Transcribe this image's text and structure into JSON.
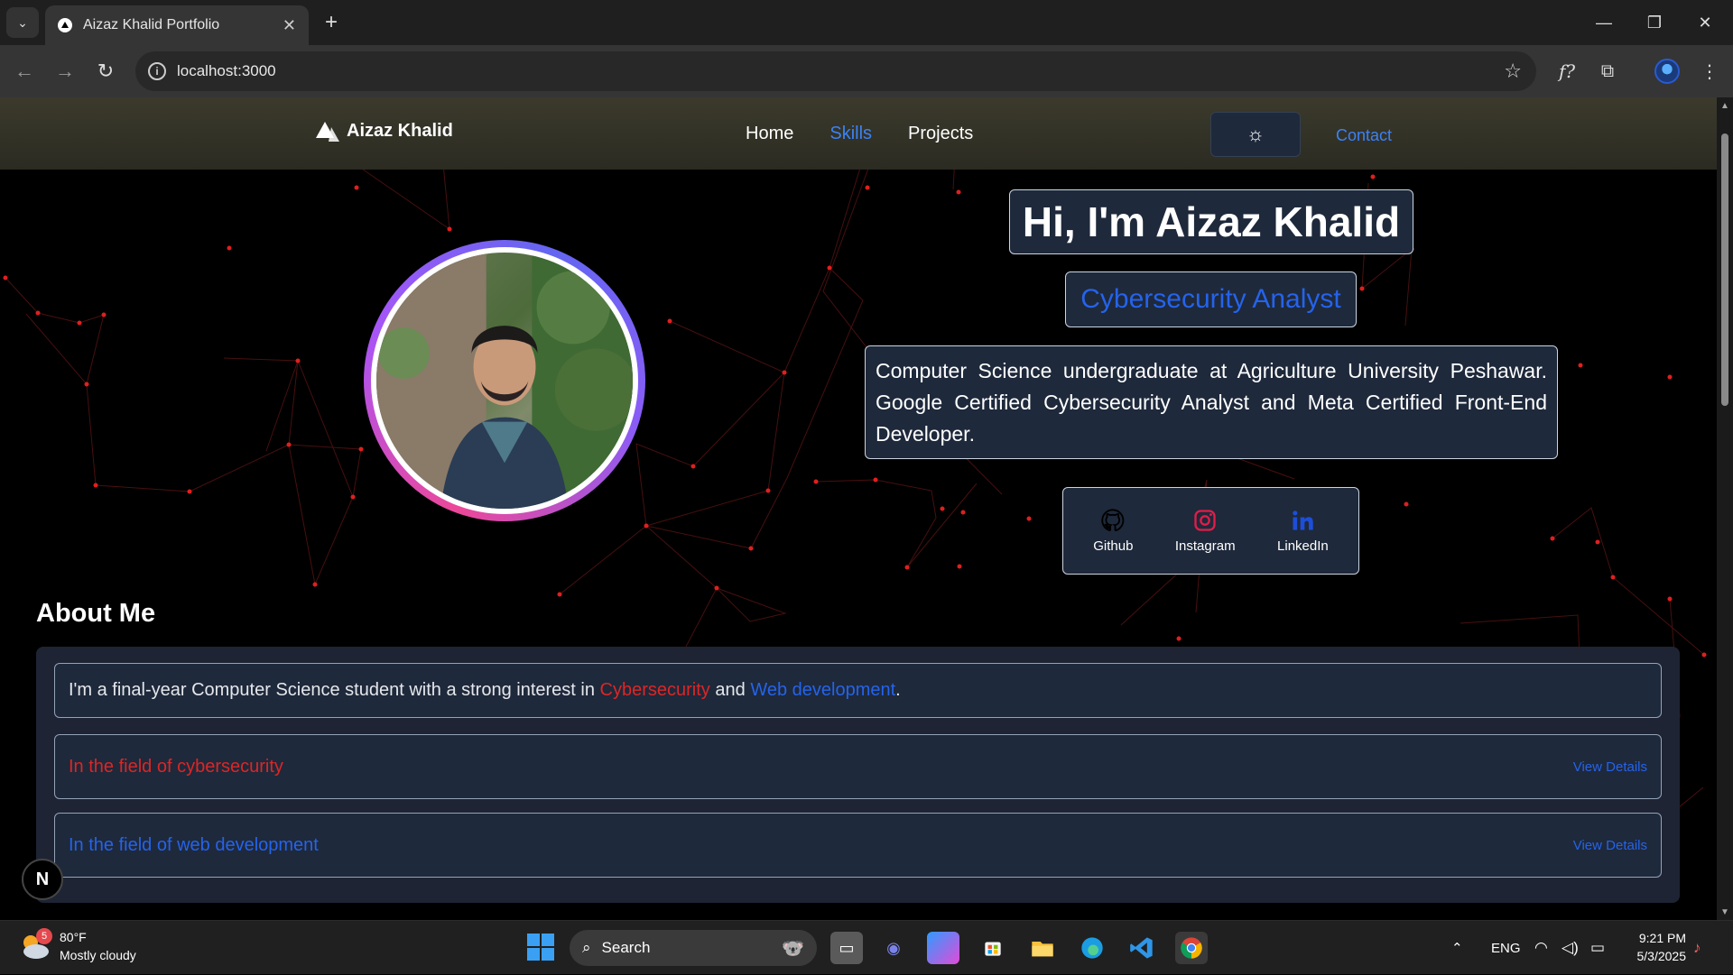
{
  "browser": {
    "tab_title": "Aizaz Khalid Portfolio",
    "url": "localhost:3000"
  },
  "site": {
    "brand": "Aizaz Khalid",
    "nav": [
      "Home",
      "Skills",
      "Projects"
    ],
    "active_nav": "Skills",
    "contact_label": "Contact",
    "accent_color": "#2563eb"
  },
  "hero": {
    "title": "Hi, I'm Aizaz Khalid",
    "subtitle": "Cybersecurity Analyst",
    "description": "Computer Science undergraduate at Agriculture University Peshawar. Google Certified Cybersecurity Analyst and Meta Certified Front-End Developer.",
    "socials": [
      {
        "label": "Github",
        "icon": "github-icon"
      },
      {
        "label": "Instagram",
        "icon": "instagram-icon"
      },
      {
        "label": "LinkedIn",
        "icon": "linkedin-icon"
      }
    ]
  },
  "about": {
    "title": "About Me",
    "intro_prefix": "I'm a final-year Computer Science student with a strong interest in",
    "intro_cyber": "Cybersecurity",
    "intro_and": "and",
    "intro_web": "Web development",
    "intro_suffix": ".",
    "rows": [
      {
        "label": "In the field of cybersecurity",
        "action": "View Details"
      },
      {
        "label": "In the field of web development",
        "action": "View Details"
      }
    ]
  },
  "dev_badge": "N",
  "taskbar": {
    "weather_temp": "80°F",
    "weather_desc": "Mostly cloudy",
    "weather_badge": "5",
    "search_label": "Search",
    "language": "ENG",
    "time": "9:21 PM",
    "date": "5/3/2025"
  }
}
